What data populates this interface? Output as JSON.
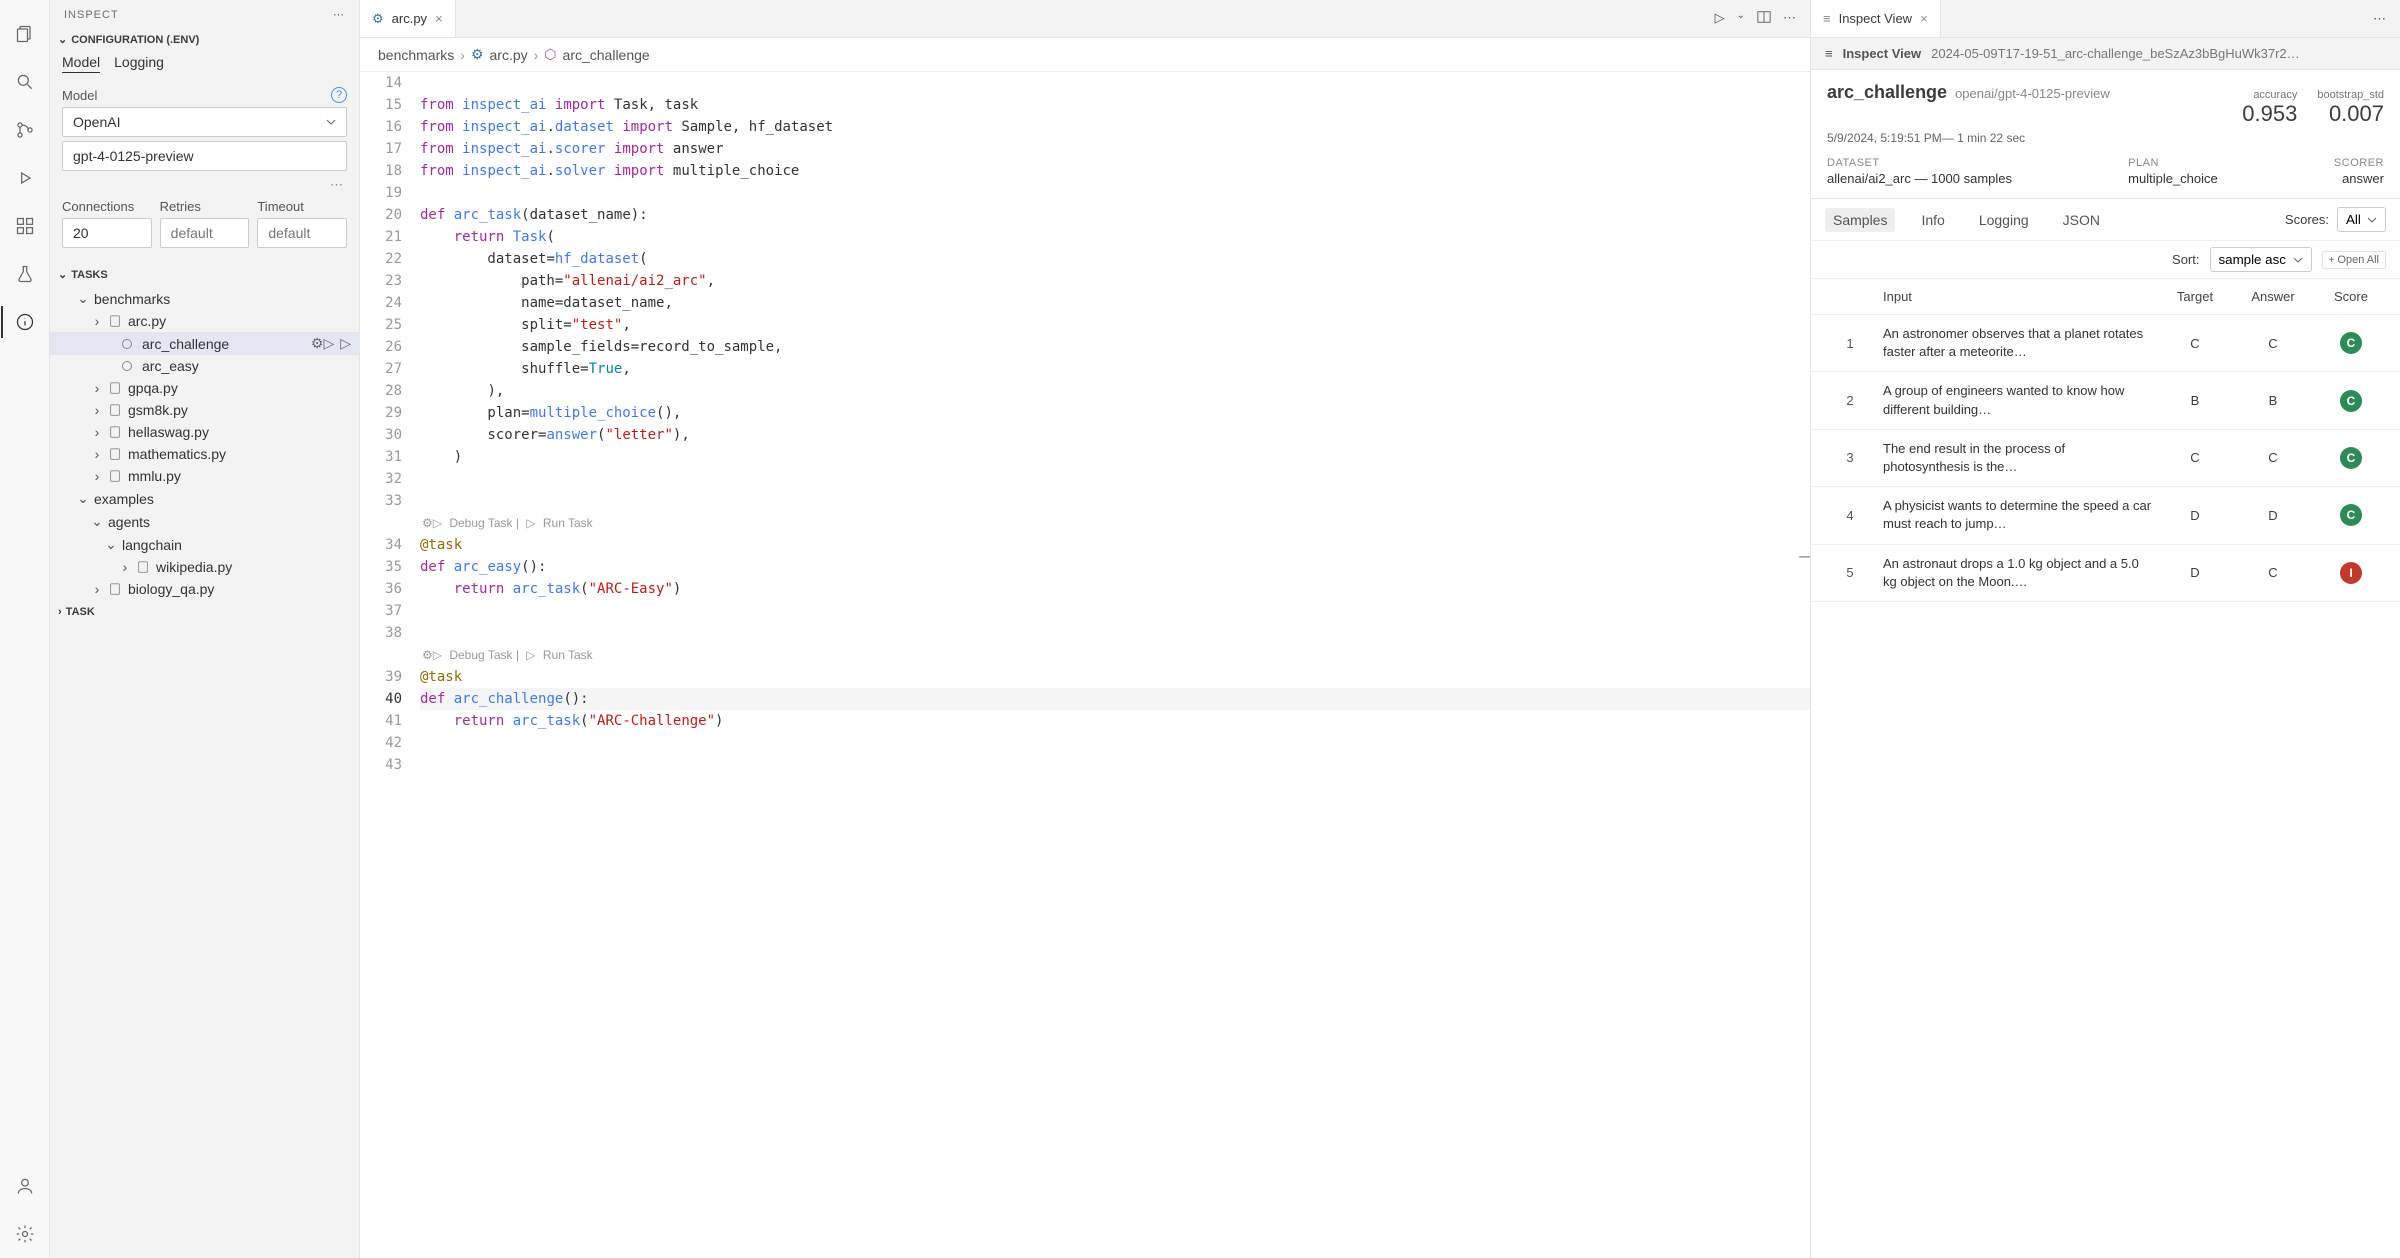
{
  "activityBar": {
    "items": [
      "files",
      "search",
      "git",
      "debug",
      "extensions",
      "beaker",
      "info"
    ],
    "bottom": [
      "account",
      "settings"
    ]
  },
  "sidebar": {
    "title": "INSPECT",
    "sections": {
      "configuration": {
        "title": "CONFIGURATION (.ENV)",
        "tabs": {
          "model": "Model",
          "logging": "Logging"
        },
        "modelLabel": "Model",
        "providerValue": "OpenAI",
        "modelValue": "gpt-4-0125-preview",
        "connectionsLabel": "Connections",
        "connectionsValue": "20",
        "retriesLabel": "Retries",
        "retriesPlaceholder": "default",
        "timeoutLabel": "Timeout",
        "timeoutPlaceholder": "default"
      },
      "tasks": {
        "title": "TASKS",
        "tree": [
          {
            "label": "benchmarks",
            "type": "folder",
            "depth": 0,
            "expanded": true
          },
          {
            "label": "arc.py",
            "type": "file",
            "depth": 1,
            "expanded": true
          },
          {
            "label": "arc_challenge",
            "type": "task",
            "depth": 2,
            "selected": true,
            "actions": true
          },
          {
            "label": "arc_easy",
            "type": "task",
            "depth": 2
          },
          {
            "label": "gpqa.py",
            "type": "file",
            "depth": 1
          },
          {
            "label": "gsm8k.py",
            "type": "file",
            "depth": 1
          },
          {
            "label": "hellaswag.py",
            "type": "file",
            "depth": 1
          },
          {
            "label": "mathematics.py",
            "type": "file",
            "depth": 1
          },
          {
            "label": "mmlu.py",
            "type": "file",
            "depth": 1
          },
          {
            "label": "examples",
            "type": "folder",
            "depth": 0,
            "expanded": true
          },
          {
            "label": "agents",
            "type": "folder",
            "depth": 1,
            "expanded": true
          },
          {
            "label": "langchain",
            "type": "folder",
            "depth": 2,
            "expanded": true
          },
          {
            "label": "wikipedia.py",
            "type": "file",
            "depth": 3
          },
          {
            "label": "biology_qa.py",
            "type": "file",
            "depth": 1
          }
        ]
      },
      "task": {
        "title": "TASK"
      }
    }
  },
  "editor": {
    "tab": {
      "icon": "python",
      "label": "arc.py"
    },
    "breadcrumb": {
      "parts": [
        "benchmarks",
        "arc.py",
        "arc_challenge"
      ]
    },
    "codelens": {
      "debug": "Debug Task",
      "run": "Run Task",
      "sep": " | "
    },
    "lines": [
      {
        "n": 14,
        "tokens": []
      },
      {
        "n": 15,
        "tokens": [
          [
            "kw",
            "from"
          ],
          [
            "",
            ""
          ],
          [
            "fn",
            "inspect_ai"
          ],
          [
            "",
            ""
          ],
          [
            "kw",
            "import"
          ],
          [
            "",
            ""
          ],
          [
            "",
            "Task, task"
          ]
        ]
      },
      {
        "n": 16,
        "tokens": [
          [
            "kw",
            "from"
          ],
          [
            "",
            ""
          ],
          [
            "fn",
            "inspect_ai"
          ],
          [
            "op",
            "."
          ],
          [
            "fn",
            "dataset"
          ],
          [
            "",
            ""
          ],
          [
            "kw",
            "import"
          ],
          [
            "",
            ""
          ],
          [
            "",
            "Sample, hf_dataset"
          ]
        ]
      },
      {
        "n": 17,
        "tokens": [
          [
            "kw",
            "from"
          ],
          [
            "",
            ""
          ],
          [
            "fn",
            "inspect_ai"
          ],
          [
            "op",
            "."
          ],
          [
            "fn",
            "scorer"
          ],
          [
            "",
            ""
          ],
          [
            "kw",
            "import"
          ],
          [
            "",
            ""
          ],
          [
            "",
            "answer"
          ]
        ]
      },
      {
        "n": 18,
        "tokens": [
          [
            "kw",
            "from"
          ],
          [
            "",
            ""
          ],
          [
            "fn",
            "inspect_ai"
          ],
          [
            "op",
            "."
          ],
          [
            "fn",
            "solver"
          ],
          [
            "",
            ""
          ],
          [
            "kw",
            "import"
          ],
          [
            "",
            ""
          ],
          [
            "",
            "multiple_choice"
          ]
        ]
      },
      {
        "n": 19,
        "tokens": []
      },
      {
        "n": 20,
        "tokens": [
          [
            "kw",
            "def"
          ],
          [
            "",
            ""
          ],
          [
            "fn",
            "arc_task"
          ],
          [
            "op",
            "("
          ],
          [
            "",
            "dataset_name"
          ],
          [
            "op",
            "):"
          ]
        ]
      },
      {
        "n": 21,
        "tokens": [
          [
            "",
            "    "
          ],
          [
            "kw",
            "return"
          ],
          [
            "",
            ""
          ],
          [
            "fn",
            "Task"
          ],
          [
            "op",
            "("
          ]
        ]
      },
      {
        "n": 22,
        "tokens": [
          [
            "",
            "        dataset"
          ],
          [
            "op",
            "="
          ],
          [
            "fn",
            "hf_dataset"
          ],
          [
            "op",
            "("
          ]
        ]
      },
      {
        "n": 23,
        "tokens": [
          [
            "",
            "            path"
          ],
          [
            "op",
            "="
          ],
          [
            "str",
            "\"allenai/ai2_arc\""
          ],
          [
            "op",
            ","
          ]
        ]
      },
      {
        "n": 24,
        "tokens": [
          [
            "",
            "            name"
          ],
          [
            "op",
            "="
          ],
          [
            "",
            "dataset_name"
          ],
          [
            "op",
            ","
          ]
        ]
      },
      {
        "n": 25,
        "tokens": [
          [
            "",
            "            split"
          ],
          [
            "op",
            "="
          ],
          [
            "str",
            "\"test\""
          ],
          [
            "op",
            ","
          ]
        ]
      },
      {
        "n": 26,
        "tokens": [
          [
            "",
            "            sample_fields"
          ],
          [
            "op",
            "="
          ],
          [
            "",
            "record_to_sample"
          ],
          [
            "op",
            ","
          ]
        ]
      },
      {
        "n": 27,
        "tokens": [
          [
            "",
            "            shuffle"
          ],
          [
            "op",
            "="
          ],
          [
            "bool",
            "True"
          ],
          [
            "op",
            ","
          ]
        ]
      },
      {
        "n": 28,
        "tokens": [
          [
            "",
            "        "
          ],
          [
            "op",
            "),"
          ]
        ]
      },
      {
        "n": 29,
        "tokens": [
          [
            "",
            "        plan"
          ],
          [
            "op",
            "="
          ],
          [
            "fn",
            "multiple_choice"
          ],
          [
            "op",
            "(),"
          ]
        ]
      },
      {
        "n": 30,
        "tokens": [
          [
            "",
            "        scorer"
          ],
          [
            "op",
            "="
          ],
          [
            "fn",
            "answer"
          ],
          [
            "op",
            "("
          ],
          [
            "str",
            "\"letter\""
          ],
          [
            "op",
            "),"
          ]
        ]
      },
      {
        "n": 31,
        "tokens": [
          [
            "",
            "    "
          ],
          [
            "op",
            ")"
          ]
        ]
      },
      {
        "n": 32,
        "tokens": []
      },
      {
        "n": 33,
        "tokens": []
      },
      {
        "n": 34,
        "codelensAbove": true,
        "tokens": [
          [
            "dec",
            "@task"
          ]
        ]
      },
      {
        "n": 35,
        "tokens": [
          [
            "kw",
            "def"
          ],
          [
            "",
            ""
          ],
          [
            "fn",
            "arc_easy"
          ],
          [
            "op",
            "():"
          ]
        ]
      },
      {
        "n": 36,
        "tokens": [
          [
            "",
            "    "
          ],
          [
            "kw",
            "return"
          ],
          [
            "",
            ""
          ],
          [
            "fn",
            "arc_task"
          ],
          [
            "op",
            "("
          ],
          [
            "str",
            "\"ARC-Easy\""
          ],
          [
            "op",
            ")"
          ]
        ]
      },
      {
        "n": 37,
        "tokens": []
      },
      {
        "n": 38,
        "tokens": []
      },
      {
        "n": 39,
        "codelensAbove": true,
        "tokens": [
          [
            "dec",
            "@task"
          ]
        ]
      },
      {
        "n": 40,
        "current": true,
        "hl": true,
        "tokens": [
          [
            "kw",
            "def"
          ],
          [
            "",
            ""
          ],
          [
            "fn",
            "arc_challenge"
          ],
          [
            "op",
            "():"
          ]
        ]
      },
      {
        "n": 41,
        "tokens": [
          [
            "",
            "    "
          ],
          [
            "kw",
            "return"
          ],
          [
            "",
            ""
          ],
          [
            "fn",
            "arc_task"
          ],
          [
            "op",
            "("
          ],
          [
            "str",
            "\"ARC-Challenge\""
          ],
          [
            "op",
            ")"
          ]
        ]
      },
      {
        "n": 42,
        "tokens": []
      },
      {
        "n": 43,
        "tokens": []
      }
    ]
  },
  "inspectView": {
    "tabLabel": "Inspect View",
    "headerLabel": "Inspect View",
    "fileName": "2024-05-09T17-19-51_arc-challenge_beSzAz3bBgHuWk37r2…",
    "summary": {
      "title": "arc_challenge",
      "model": "openai/gpt-4-0125-preview",
      "time": "5/9/2024, 5:19:51 PM— 1 min 22 sec",
      "metrics": {
        "accuracy": {
          "label": "accuracy",
          "value": "0.953"
        },
        "bootstrap": {
          "label": "bootstrap_std",
          "value": "0.007"
        }
      },
      "meta": {
        "dataset": {
          "label": "DATASET",
          "value": "allenai/ai2_arc — 1000 samples"
        },
        "plan": {
          "label": "PLAN",
          "value": "multiple_choice"
        },
        "scorer": {
          "label": "SCORER",
          "value": "answer"
        }
      }
    },
    "tabs": {
      "samples": "Samples",
      "info": "Info",
      "logging": "Logging",
      "json": "JSON"
    },
    "scoresLabel": "Scores:",
    "scoresValue": "All",
    "sortLabel": "Sort:",
    "sortValue": "sample asc",
    "openAll": "Open All",
    "columns": {
      "input": "Input",
      "target": "Target",
      "answer": "Answer",
      "score": "Score"
    },
    "rows": [
      {
        "idx": "1",
        "input": "An astronomer observes that a planet rotates faster after a meteorite…",
        "target": "C",
        "answer": "C",
        "score": "C",
        "correct": true
      },
      {
        "idx": "2",
        "input": "A group of engineers wanted to know how different building…",
        "target": "B",
        "answer": "B",
        "score": "C",
        "correct": true
      },
      {
        "idx": "3",
        "input": "The end result in the process of photosynthesis is the…",
        "target": "C",
        "answer": "C",
        "score": "C",
        "correct": true
      },
      {
        "idx": "4",
        "input": "A physicist wants to determine the speed a car must reach to jump…",
        "target": "D",
        "answer": "D",
        "score": "C",
        "correct": true
      },
      {
        "idx": "5",
        "input": "An astronaut drops a 1.0 kg object and a 5.0 kg object on the Moon.…",
        "target": "D",
        "answer": "C",
        "score": "I",
        "correct": false
      }
    ]
  }
}
